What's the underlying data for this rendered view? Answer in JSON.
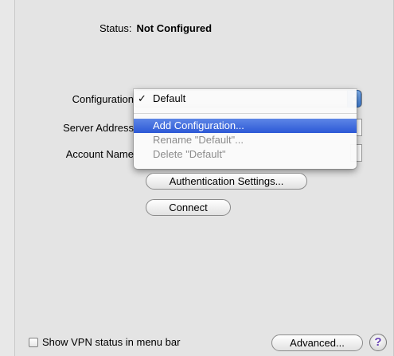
{
  "status": {
    "label": "Status:",
    "value": "Not Configured"
  },
  "form": {
    "configuration_label": "Configuration",
    "server_address_label": "Server Address",
    "account_name_label": "Account Name"
  },
  "config_menu": {
    "items": [
      {
        "label": "Default",
        "checked": true,
        "state": "normal"
      },
      {
        "label": "Add Configuration...",
        "state": "selected"
      },
      {
        "label": "Rename \"Default\"...",
        "state": "disabled"
      },
      {
        "label": "Delete \"Default\"",
        "state": "disabled"
      }
    ],
    "check_glyph": "✓"
  },
  "buttons": {
    "auth_settings": "Authentication Settings...",
    "connect": "Connect",
    "advanced": "Advanced...",
    "help": "?"
  },
  "menu_bar_option": {
    "label": "Show VPN status in menu bar",
    "checked": false
  },
  "colors": {
    "selection": "#2c58d6",
    "popup_arrow": "#3f7ed7"
  },
  "icons": {
    "popup_arrows": "up-down-arrows-icon",
    "help": "help-icon"
  }
}
